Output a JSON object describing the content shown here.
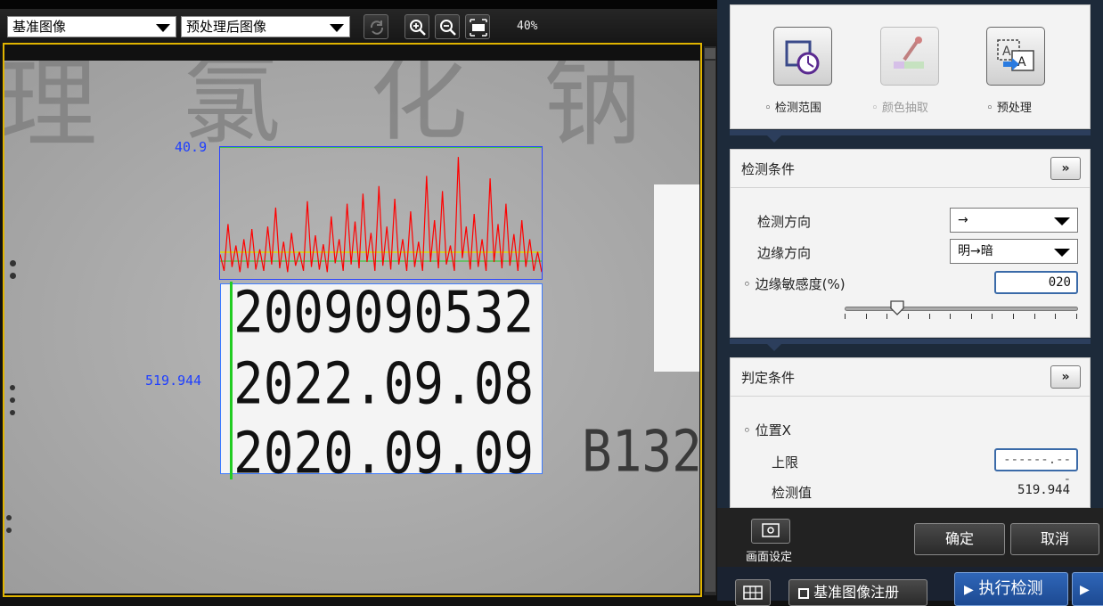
{
  "toolbar": {
    "reference_image_select": "基准图像",
    "processed_image_select": "预处理后图像",
    "zoom_level": "40%"
  },
  "viewer": {
    "background_chars": [
      "理",
      "氯",
      "化",
      "钠"
    ],
    "printed_lines": [
      "2009090532",
      "2022.09.08",
      "2020.09.09"
    ],
    "side_text": "B132",
    "peak_label": "40.9",
    "position_label": "519.944",
    "waveform_peaks": [
      0.18,
      0.05,
      0.42,
      0.08,
      0.25,
      0.04,
      0.3,
      0.07,
      0.38,
      0.06,
      0.22,
      0.05,
      0.4,
      0.1,
      0.55,
      0.07,
      0.28,
      0.04,
      0.35,
      0.09,
      0.2,
      0.05,
      0.6,
      0.08,
      0.33,
      0.06,
      0.26,
      0.04,
      0.48,
      0.11,
      0.3,
      0.05,
      0.58,
      0.1,
      0.44,
      0.07,
      0.66,
      0.12,
      0.35,
      0.05,
      0.72,
      0.09,
      0.4,
      0.06,
      0.62,
      0.1,
      0.3,
      0.05,
      0.52,
      0.08,
      0.28,
      0.05,
      0.8,
      0.12,
      0.45,
      0.07,
      0.68,
      0.1,
      0.25,
      0.05,
      0.95,
      0.15,
      0.4,
      0.06,
      0.5,
      0.08,
      0.3,
      0.05,
      0.78,
      0.12,
      0.42,
      0.07,
      0.58,
      0.09,
      0.34,
      0.05,
      0.45,
      0.08,
      0.3,
      0.05,
      0.2,
      0.04
    ],
    "colors": {
      "frame": "#e0b400",
      "histogram_line": "#ff0000",
      "roi_box": "#1f3fff",
      "edge_line": "#22cc22"
    }
  },
  "tools": [
    {
      "label": "检测范围",
      "icon": "detection-range-icon",
      "enabled": true
    },
    {
      "label": "颜色抽取",
      "icon": "color-extract-icon",
      "enabled": false
    },
    {
      "label": "预处理",
      "icon": "preprocess-icon",
      "enabled": true
    }
  ],
  "detection": {
    "title": "检测条件",
    "expand": "»",
    "direction_label": "检测方向",
    "direction_value": "→",
    "edge_direction_label": "边缘方向",
    "edge_direction_value": "明→暗",
    "sensitivity_label": "边缘敏感度(%)",
    "sensitivity_value": "020",
    "sensitivity_level": 0.2
  },
  "judgement": {
    "title": "判定条件",
    "expand": "»",
    "position_label": "位置X",
    "upper_label": "上限",
    "upper_value": "------.---",
    "measured_label": "检测值",
    "measured_value": "519.944"
  },
  "bottom": {
    "screen_settings": "画面设定",
    "ok": "确定",
    "cancel": "取消",
    "register_reference": "基准图像注册",
    "run_detection": "执行检测"
  }
}
